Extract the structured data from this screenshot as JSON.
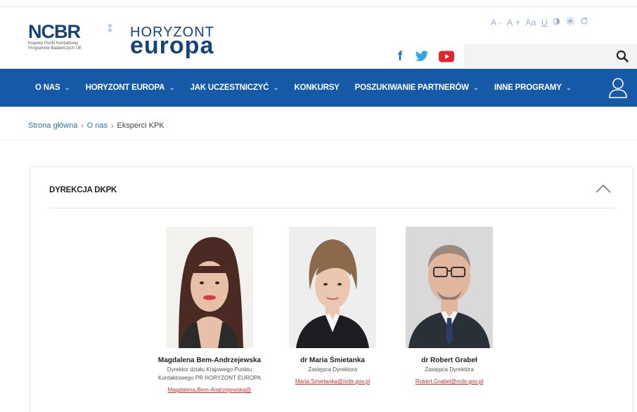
{
  "header": {
    "ncbr_logo": "NCBR",
    "ncbr_subtitle_line1": "Krajowy Punkt Kontaktowy",
    "ncbr_subtitle_line2": "Programów Badawczych UE",
    "he_logo_top": "HORYZONT",
    "he_logo_bottom": "europa",
    "accessibility": {
      "font_decrease": "A -",
      "font_increase": "A +",
      "font_style": "Aa",
      "underline": "U"
    },
    "social": {
      "facebook": "f",
      "facebook_color": "#1668b8",
      "twitter_color": "#2ea6e6",
      "youtube_color": "#e3262d"
    },
    "search": {
      "placeholder": "",
      "value": ""
    }
  },
  "nav": {
    "items": [
      {
        "label": "O NAS",
        "has_dropdown": true
      },
      {
        "label": "HORYZONT EUROPA",
        "has_dropdown": true
      },
      {
        "label": "JAK UCZESTNICZYĆ",
        "has_dropdown": true
      },
      {
        "label": "KONKURSY",
        "has_dropdown": false
      },
      {
        "label": "POSZUKIWANIE PARTNERÓW",
        "has_dropdown": true
      },
      {
        "label": "INNE PROGRAMY",
        "has_dropdown": true
      }
    ],
    "chevron": "⌄",
    "background": "#165aa7"
  },
  "breadcrumb": {
    "home": "Strona główna",
    "level1": "O nas",
    "current": "Eksperci KPK",
    "separator": "›"
  },
  "panel": {
    "title": "DYREKCJA DKPK",
    "people": [
      {
        "name": "Magdalena Bem-Andrzejewska",
        "role_line1": "Dyrektor działu Krajowego Punktu",
        "role_line2": "Kontaktowego PR HORYZONT EUROPA",
        "email": "Magdalena.Bem-Andrzejewska@"
      },
      {
        "name": "dr Maria Śmietanka",
        "role_line1": "Zastępca Dyrektora",
        "role_line2": "",
        "email": "Maria.Smietanka@ncbr.gov.pl"
      },
      {
        "name": "dr Robert Grabeł",
        "role_line1": "Zastępca Dyrektora",
        "role_line2": "",
        "email": "Robert.Grabel@ncbr.gov.pl"
      }
    ]
  }
}
